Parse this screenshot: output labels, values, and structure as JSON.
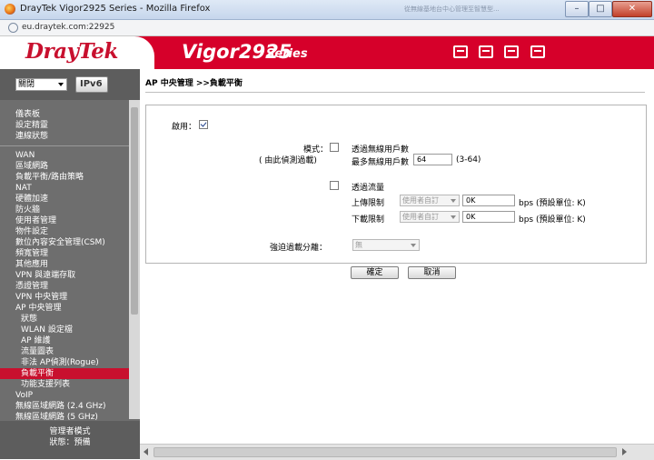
{
  "window": {
    "title": "DrayTek Vigor2925 Series - Mozilla Firefox",
    "ghost_tabs": [
      "從無線基地台中心管理至智慧型..."
    ],
    "controls": [
      "–",
      "□",
      "✕"
    ]
  },
  "address_bar": {
    "url": "eu.draytek.com:22925"
  },
  "banner": {
    "logo": "DrayTek",
    "model": "Vigor2925",
    "series": "Series",
    "toolbar_icons": [
      "menu-icon",
      "settings-sliders-icon",
      "save-icon",
      "logout-icon"
    ]
  },
  "sidebar": {
    "language_select": "關閉",
    "ipv6_label": "IPv6",
    "group1": [
      "儀表板",
      "設定精靈",
      "連線狀態"
    ],
    "group2": [
      {
        "label": "WAN",
        "sub": false,
        "active": false
      },
      {
        "label": "區域網路",
        "sub": false,
        "active": false
      },
      {
        "label": "負載平衡/路由策略",
        "sub": false,
        "active": false
      },
      {
        "label": "NAT",
        "sub": false,
        "active": false
      },
      {
        "label": "硬體加速",
        "sub": false,
        "active": false
      },
      {
        "label": "防火牆",
        "sub": false,
        "active": false
      },
      {
        "label": "使用者管理",
        "sub": false,
        "active": false
      },
      {
        "label": "物件設定",
        "sub": false,
        "active": false
      },
      {
        "label": "數位內容安全管理(CSM)",
        "sub": false,
        "active": false
      },
      {
        "label": "頻寬管理",
        "sub": false,
        "active": false
      },
      {
        "label": "其他應用",
        "sub": false,
        "active": false
      },
      {
        "label": "VPN 與遠端存取",
        "sub": false,
        "active": false
      },
      {
        "label": "憑證管理",
        "sub": false,
        "active": false
      },
      {
        "label": "VPN 中央管理",
        "sub": false,
        "active": false
      },
      {
        "label": "AP 中央管理",
        "sub": false,
        "active": false
      },
      {
        "label": "狀態",
        "sub": true,
        "active": false
      },
      {
        "label": "WLAN 設定檔",
        "sub": true,
        "active": false
      },
      {
        "label": "AP 維護",
        "sub": true,
        "active": false
      },
      {
        "label": "流量圖表",
        "sub": true,
        "active": false
      },
      {
        "label": "非法 AP偵測(Rogue)",
        "sub": true,
        "active": false
      },
      {
        "label": "負載平衡",
        "sub": true,
        "active": true
      },
      {
        "label": "功能支援列表",
        "sub": true,
        "active": false
      },
      {
        "label": "VoIP",
        "sub": false,
        "active": false
      },
      {
        "label": "無線區域網路 (2.4 GHz)",
        "sub": false,
        "active": false
      },
      {
        "label": "無線區域網路 (5 GHz)",
        "sub": false,
        "active": false
      }
    ],
    "footer": {
      "mode": "管理者模式",
      "status": "狀態：預備"
    }
  },
  "content": {
    "breadcrumb": "AP 中央管理 >>負載平衡",
    "form": {
      "enable_label": "啟用：",
      "enable_checked": true,
      "mode_label": "模式：",
      "mode_sub_label": "( 由此偵測過載)",
      "mode_checked": false,
      "by_users_label": "透過無線用戶數",
      "max_users_label": "最多無線用戶數",
      "max_users_value": "64",
      "max_users_range": "(3-64)",
      "by_traffic_checked": false,
      "by_traffic_label": "透過流量",
      "upload_label": "上傳限制",
      "upload_select": "使用者自訂",
      "upload_value": "0K",
      "upload_unit": "bps (預設單位: K)",
      "download_label": "下載限制",
      "download_select": "使用者自訂",
      "download_value": "0K",
      "download_unit": "bps (預設單位: K)",
      "force_label": "強迫過載分離：",
      "force_select": "無"
    },
    "ok_label": "確定",
    "cancel_label": "取消"
  },
  "colors": {
    "brand_red": "#d6002a",
    "sidebar_gray": "#6e6e6e",
    "active_item": "#c8102e"
  }
}
